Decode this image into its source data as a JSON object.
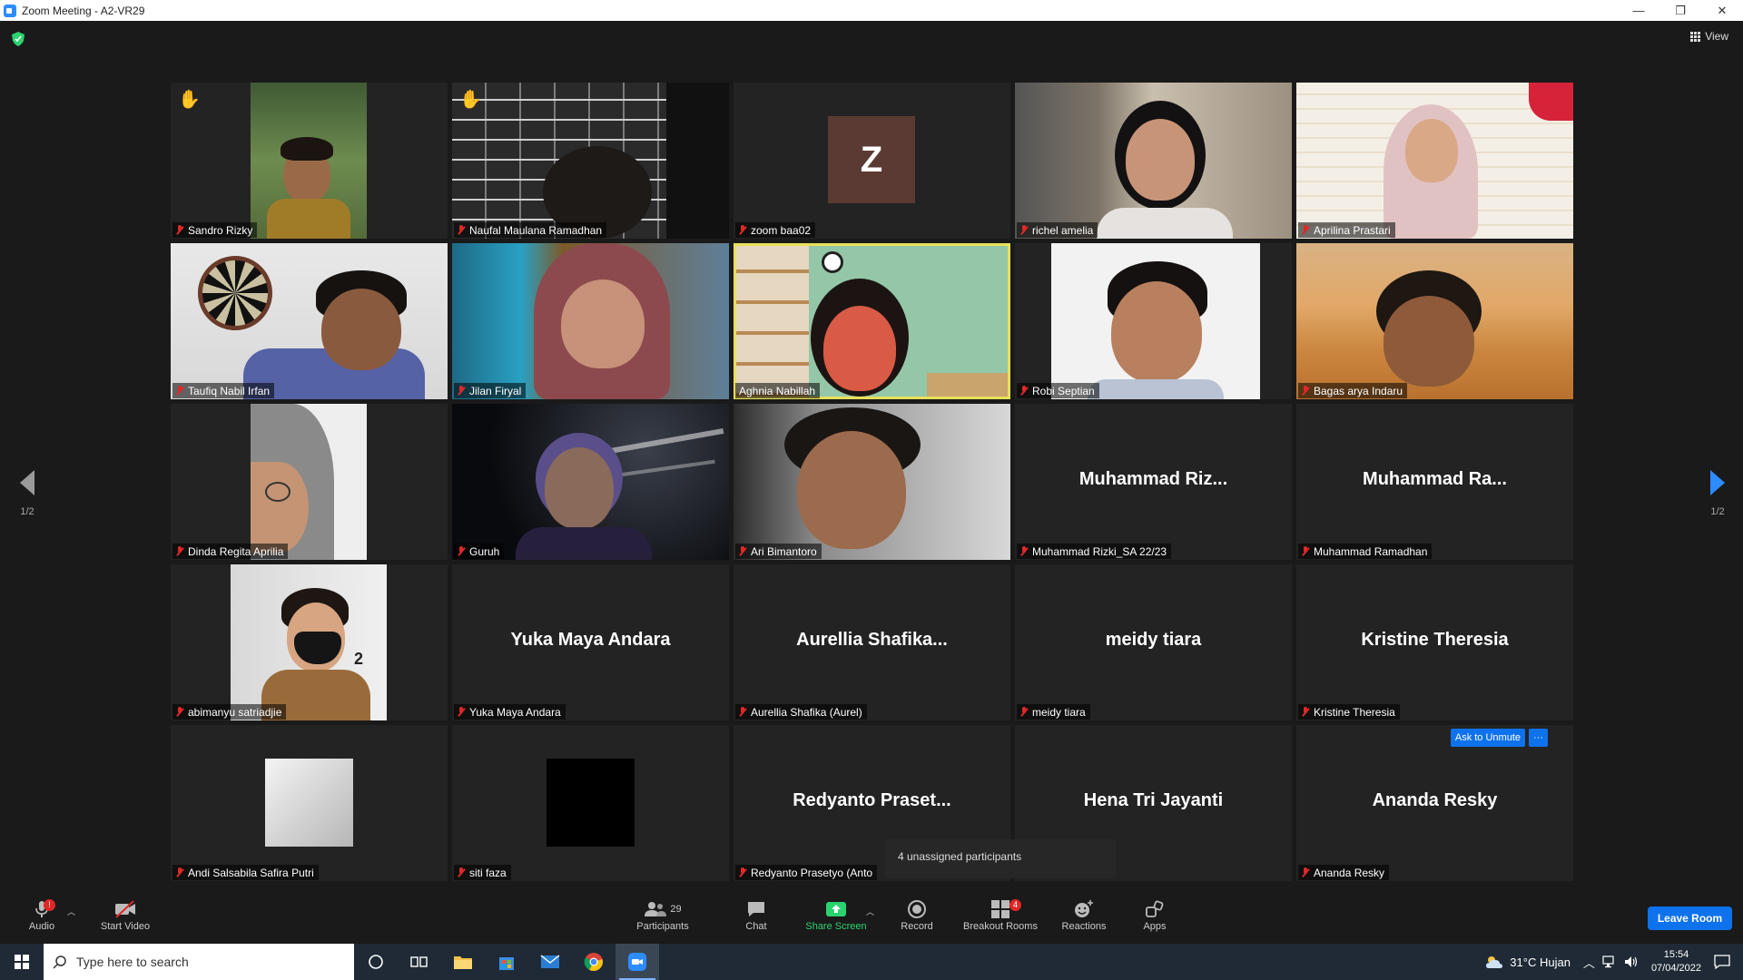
{
  "window": {
    "title": "Zoom Meeting - A2-VR29",
    "controls": {
      "minimize": "—",
      "restore": "❐",
      "close": "✕"
    }
  },
  "top": {
    "view_label": "View"
  },
  "pager": {
    "left": "1/2",
    "right": "1/2"
  },
  "tiles": [
    {
      "name": "Sandro Rizky",
      "hand": true
    },
    {
      "name": "Naufal Maulana Ramadhan",
      "hand": true
    },
    {
      "name": "zoom baa02",
      "initial": "Z"
    },
    {
      "name": "richel amelia"
    },
    {
      "name": "Aprilina Prastari"
    },
    {
      "name": "Taufiq Nabil Irfan"
    },
    {
      "name": "Jilan Firyal"
    },
    {
      "name": "Aghnia Nabillah",
      "active": true
    },
    {
      "name": "Robi Septian"
    },
    {
      "name": "Bagas arya Indaru"
    },
    {
      "name": "Dinda Regita Aprilia"
    },
    {
      "name": "Guruh"
    },
    {
      "name": "Ari Bimantoro"
    },
    {
      "name": "Muhammad Rizki_SA 22/23",
      "display": "Muhammad  Riz..."
    },
    {
      "name": "Muhammad Ramadhan",
      "display": "Muhammad  Ra..."
    },
    {
      "name": "abimanyu satriadjie"
    },
    {
      "name": "Yuka Maya Andara",
      "display": "Yuka Maya Andara"
    },
    {
      "name": "Aurellia Shafika (Aurel)",
      "display": "Aurellia  Shafika..."
    },
    {
      "name": "meidy tiara",
      "display": "meidy tiara"
    },
    {
      "name": "Kristine Theresia",
      "display": "Kristine Theresia"
    },
    {
      "name": "Andi Salsabila Safira Putri"
    },
    {
      "name": "siti faza"
    },
    {
      "name": "Redyanto Prasetyo (Anto",
      "display": "Redyanto  Praset..."
    },
    {
      "name": "",
      "display": "Hena Tri Jayanti"
    },
    {
      "name": "Ananda Resky",
      "display": "Ananda Resky"
    }
  ],
  "hover": {
    "ask_unmute": "Ask to Unmute",
    "more": "···"
  },
  "tooltip": "4 unassigned participants",
  "toolbar": {
    "audio": "Audio",
    "start_video": "Start Video",
    "participants": "Participants",
    "participants_count": "29",
    "chat": "Chat",
    "share_screen": "Share Screen",
    "record": "Record",
    "breakout_rooms": "Breakout Rooms",
    "breakout_badge": "4",
    "reactions": "Reactions",
    "apps": "Apps",
    "leave": "Leave Room",
    "audio_badge": "!"
  },
  "taskbar": {
    "search_placeholder": "Type here to search",
    "weather": "31°C  Hujan",
    "time": "15:54",
    "date": "07/04/2022"
  },
  "colors": {
    "accent": "#0e72ed",
    "active_speaker": "#e8e05a",
    "muted": "#e02828",
    "share": "#2bd36f"
  }
}
